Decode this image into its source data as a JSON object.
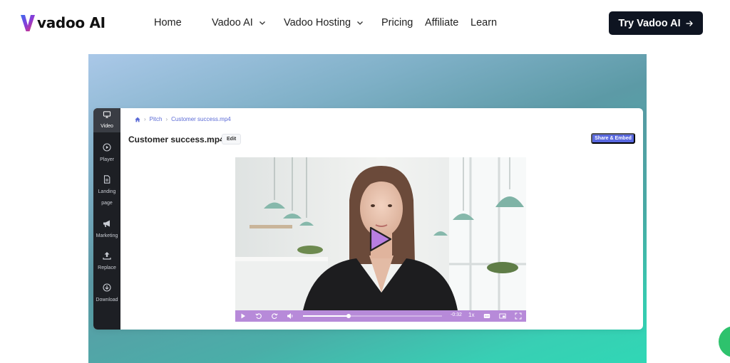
{
  "header": {
    "logo_text": "vadoo AI",
    "nav": [
      {
        "label": "Home",
        "dropdown": false
      },
      {
        "label": "Vadoo AI",
        "dropdown": true
      },
      {
        "label": "Vadoo Hosting",
        "dropdown": true
      },
      {
        "label": "Pricing",
        "dropdown": false
      },
      {
        "label": "Affiliate",
        "dropdown": false
      },
      {
        "label": "Learn",
        "dropdown": false
      }
    ],
    "cta_label": "Try Vadoo AI"
  },
  "app": {
    "sidebar": [
      {
        "label": "Video",
        "icon": "monitor-icon",
        "active": true
      },
      {
        "label": "Player",
        "icon": "play-circle-icon",
        "active": false
      },
      {
        "label": "Landing page",
        "icon": "document-icon",
        "active": false
      },
      {
        "label": "Marketing",
        "icon": "megaphone-icon",
        "active": false
      },
      {
        "label": "Replace",
        "icon": "upload-icon",
        "active": false
      },
      {
        "label": "Download",
        "icon": "download-icon",
        "active": false
      }
    ],
    "breadcrumb": [
      "Pitch",
      "Customer success.mp4"
    ],
    "title": "Customer success.mp4",
    "edit_label": "Edit",
    "share_label": "Share & Embed",
    "player": {
      "time_remaining": "-0:32",
      "speed": "1x",
      "progress": 0.33
    }
  },
  "colors": {
    "cta_bg": "#0e1421",
    "sidebar_bg": "#1d1f24",
    "share_button": "#5968df",
    "player_controls": "#b78ad9",
    "breadcrumb_link": "#5a6ad6"
  }
}
